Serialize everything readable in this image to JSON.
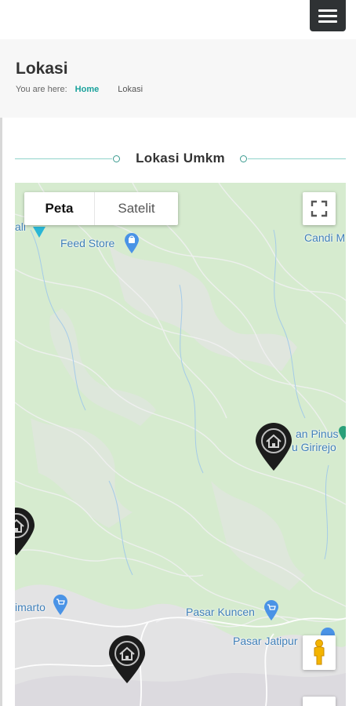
{
  "header": {
    "menu_icon": "hamburger-menu-icon"
  },
  "page": {
    "title": "Lokasi",
    "breadcrumb": {
      "prefix": "You are here:",
      "home": "Home",
      "current": "Lokasi"
    }
  },
  "section": {
    "title": "Lokasi Umkm"
  },
  "map": {
    "type_controls": {
      "map_label": "Peta",
      "satellite_label": "Satelit",
      "selected": "Peta"
    },
    "labels": {
      "feed_store": "Feed Store",
      "candi": "Candi M",
      "hutan_pinus_line1": "an Pinus",
      "hutan_pinus_line2": "u Girirejo",
      "pasar_kuncen": "Pasar Kuncen",
      "pasar_jatipuro": "Pasar Jatipur",
      "imarto": "imarto",
      "ali": "ali"
    },
    "markers": [
      "umkm-marker-home",
      "umkm-marker-home",
      "umkm-marker-home"
    ],
    "colors": {
      "land": "#d9ecd2",
      "roads": "#e9e6ea",
      "water": "#8ec3f2",
      "poi": "#4a93e6",
      "marker": "#1c1c1c",
      "accent": "#1aa29c"
    }
  }
}
